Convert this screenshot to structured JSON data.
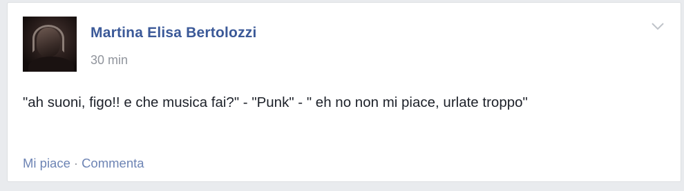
{
  "post": {
    "author": "Martina Elisa Bertolozzi",
    "time": "30 min",
    "text": "\"ah suoni, figo!! e che musica fai?\" - \"Punk\" - \" eh no non mi piace, urlate troppo\"",
    "actions": {
      "like": "Mi piace",
      "separator": "·",
      "comment": "Commenta"
    },
    "menu_icon": "chevron-down-icon"
  },
  "colors": {
    "author": "#3b5998",
    "link": "#6d84b4",
    "meta": "#90949c",
    "text": "#1d2129",
    "background": "#e9ebee"
  }
}
